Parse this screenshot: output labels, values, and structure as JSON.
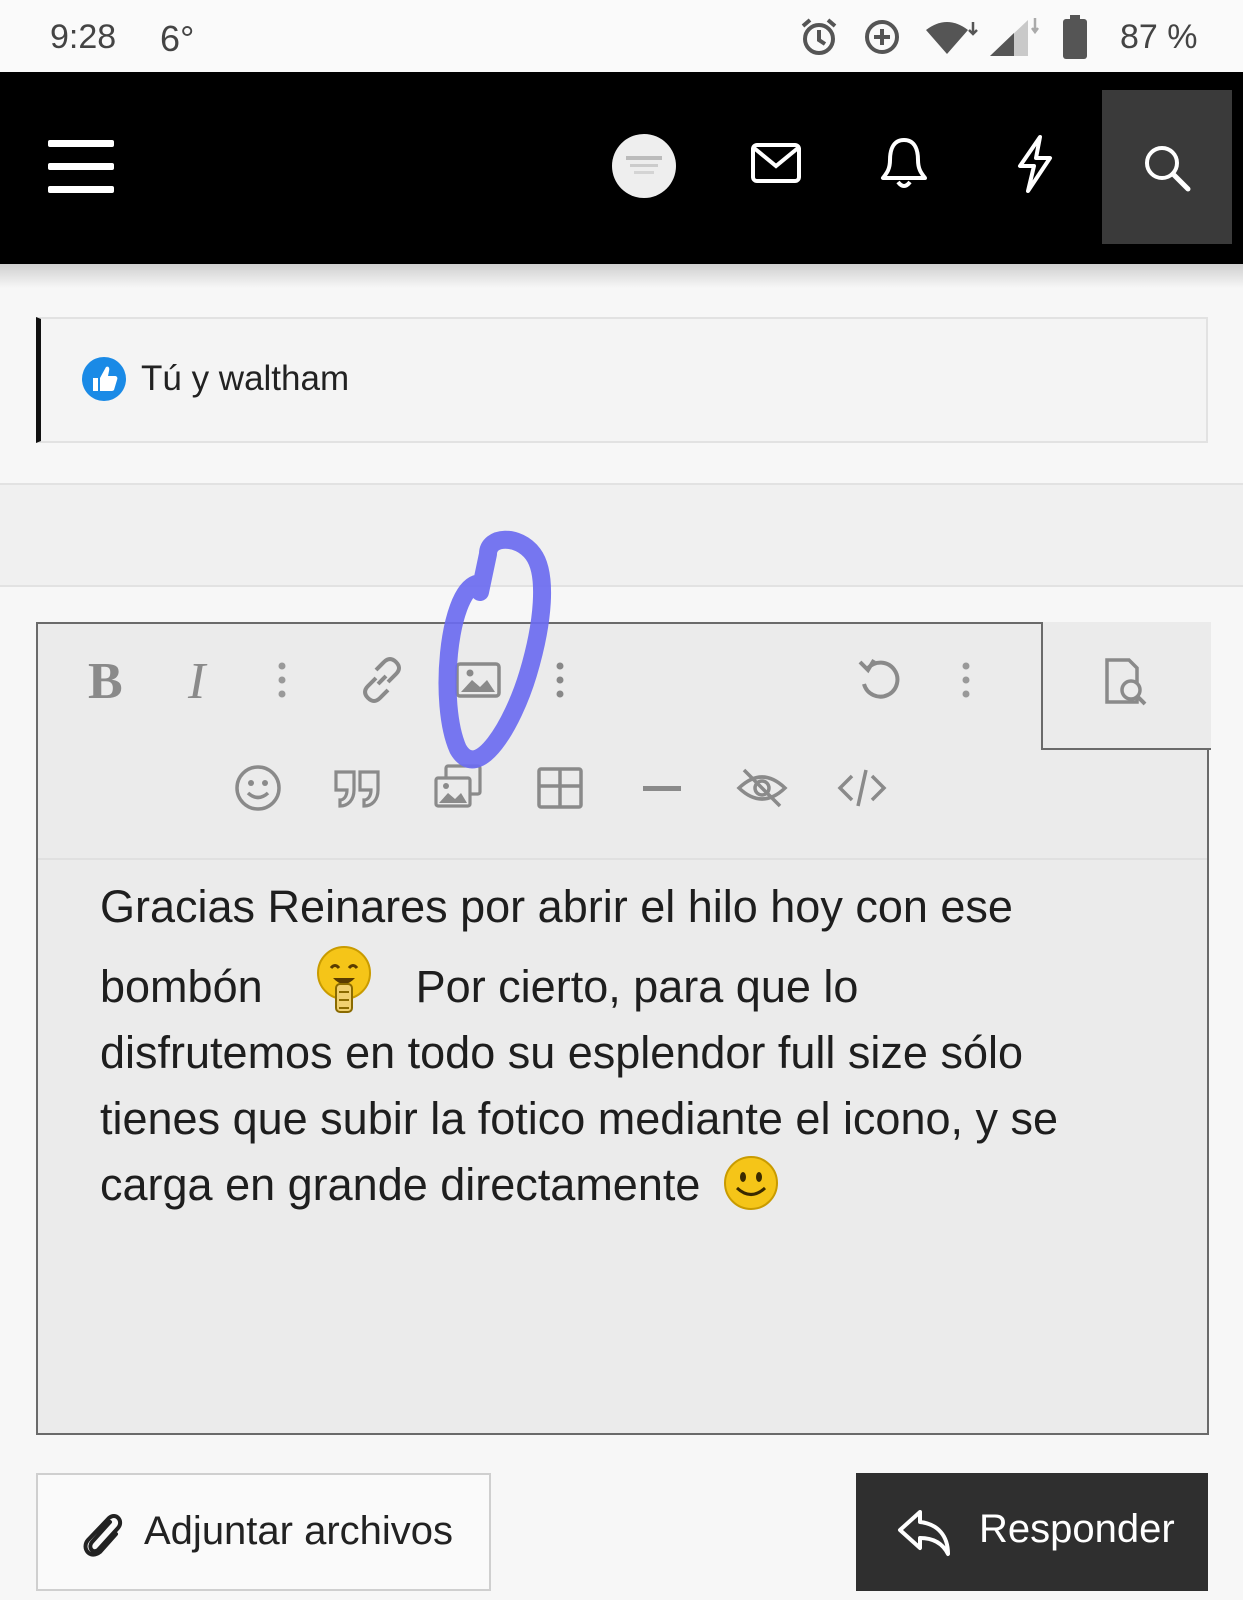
{
  "status_bar": {
    "time": "9:28",
    "temperature": "6°",
    "battery": "87 %",
    "icons": [
      "alarm-icon",
      "data-saver-icon",
      "wifi-icon",
      "signal-icon",
      "battery-icon"
    ]
  },
  "nav": {
    "icons": [
      "menu-icon",
      "avatar",
      "mail-icon",
      "bell-icon",
      "lightning-icon",
      "search-icon"
    ]
  },
  "reactions": {
    "label": "Tú y waltham",
    "icon": "thumbs-up-icon",
    "color": "#1a8ae6"
  },
  "editor": {
    "toolbar_row1": [
      "bold-icon",
      "italic-icon",
      "more-text-icon",
      "link-icon",
      "image-icon",
      "more-insert-icon",
      "undo-icon",
      "more-options-icon",
      "preview-icon"
    ],
    "toolbar_row2": [
      "emoji-icon",
      "quote-icon",
      "media-icon",
      "table-icon",
      "horizontal-rule-icon",
      "spoiler-icon",
      "code-icon"
    ],
    "text": {
      "line1": "Gracias Reinares por abrir el hilo hoy con ese",
      "line2_before": "bombón",
      "line2_after": "Por cierto, para que lo",
      "line3": "disfrutemos en todo su esplendor full size sólo",
      "line4": "tienes que subir la fotico mediante el icono, y se",
      "line5": "carga en grande directamente"
    },
    "annotation_color": "#6b6bf0"
  },
  "buttons": {
    "attach": "Adjuntar archivos",
    "reply": "Responder"
  }
}
